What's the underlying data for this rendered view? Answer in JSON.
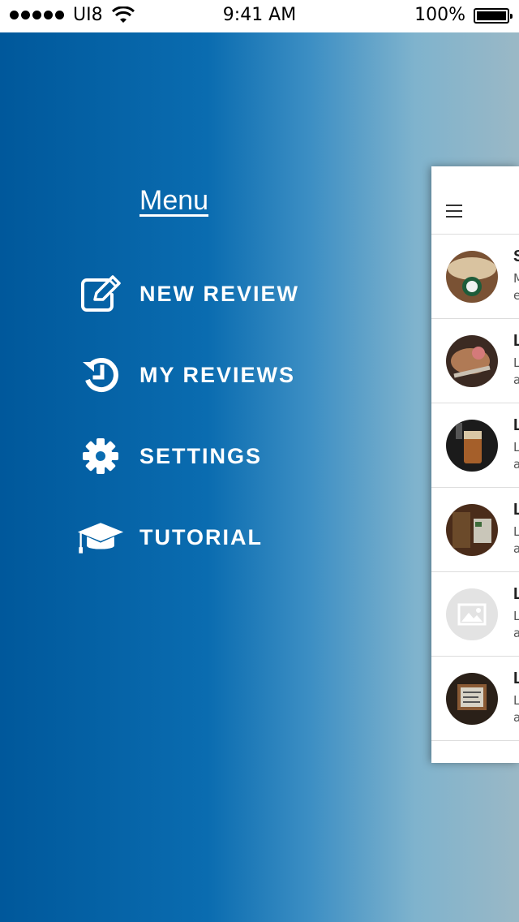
{
  "status_bar": {
    "carrier": "UI8",
    "time": "9:41 AM",
    "battery": "100%"
  },
  "menu": {
    "title": "Menu",
    "items": [
      {
        "label": "NEW REVIEW",
        "icon": "edit-icon"
      },
      {
        "label": "MY REVIEWS",
        "icon": "history-icon"
      },
      {
        "label": "SETTINGS",
        "icon": "gear-icon"
      },
      {
        "label": "TUTORIAL",
        "icon": "graduation-cap-icon"
      }
    ]
  },
  "preview": {
    "rows": [
      {
        "letter": "S",
        "line1": "M",
        "line2": "e"
      },
      {
        "letter": "L",
        "line1": "L",
        "line2": "a"
      },
      {
        "letter": "L",
        "line1": "L",
        "line2": "a"
      },
      {
        "letter": "L",
        "line1": "L",
        "line2": "a"
      },
      {
        "letter": "L",
        "line1": "L",
        "line2": "a"
      },
      {
        "letter": "L",
        "line1": "L",
        "line2": "a"
      }
    ]
  },
  "colors": {
    "gradient_start": "#00589b",
    "gradient_end": "#9ab8c6",
    "text": "#ffffff"
  }
}
